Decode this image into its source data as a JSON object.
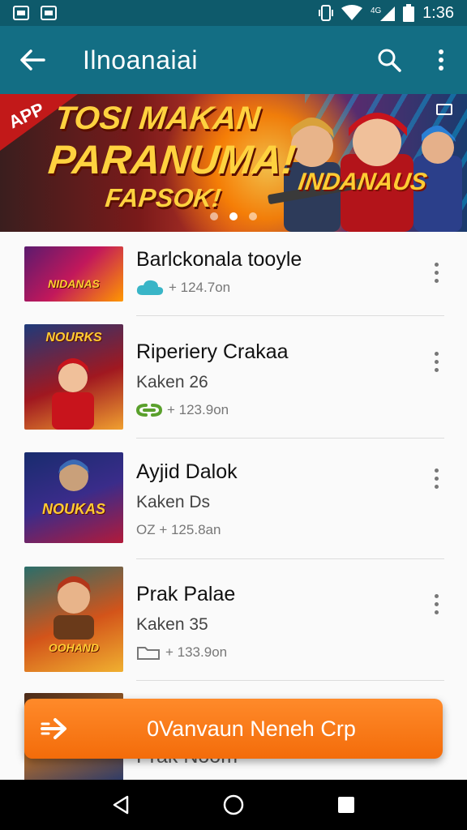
{
  "status_bar": {
    "time": "1:36",
    "icons": [
      "picture-icon",
      "notification-icon",
      "vibrate-icon",
      "wifi-icon",
      "signal-icon",
      "battery-icon"
    ]
  },
  "app_bar": {
    "title": "Ilnoanaiai",
    "back_icon": "arrow-back-icon",
    "search_icon": "search-icon",
    "menu_icon": "more-vert-icon"
  },
  "banner": {
    "tag": "APP",
    "headline_1": "TOSI MAKAN",
    "headline_2": "PARANUMA!",
    "headline_3": "FAPSOK!",
    "logo_text": "INDANAUS",
    "carousel_dots": 3,
    "active_dot": 1
  },
  "items": [
    {
      "title": "Barlckonala tooyle",
      "subtitle": "",
      "meta_icon": "cloud-icon",
      "meta": "+ 124.7on",
      "thumb_text": "NIDANAS",
      "accent": "#39b5c7"
    },
    {
      "title": "Riperiery Crakaa",
      "subtitle": "Kaken 26",
      "meta_icon": "link-icon",
      "meta": "+ 123.9on",
      "thumb_text": "NOURKS",
      "accent": "#5aa02c"
    },
    {
      "title": "Ayjid Dalok",
      "subtitle": "Kaken Ds",
      "meta_icon": "ozone-icon",
      "meta": "OZ + 125.8an",
      "thumb_text": "NOUKAS",
      "accent": "#888888"
    },
    {
      "title": "Prak Palae",
      "subtitle": "Kaken 35",
      "meta_icon": "folder-icon",
      "meta": "+ 133.9on",
      "thumb_text": "OOHAND",
      "accent": "#888888"
    },
    {
      "title": "Prak Noom",
      "subtitle": "",
      "meta_icon": "",
      "meta": "",
      "thumb_text": "",
      "accent": "#888888"
    }
  ],
  "fab": {
    "label": "0Vanvaun Neneh Crp",
    "icon": "arrow-forward-icon"
  },
  "nav_bar": {
    "back": "nav-back-icon",
    "home": "nav-home-icon",
    "recents": "nav-recents-icon"
  }
}
